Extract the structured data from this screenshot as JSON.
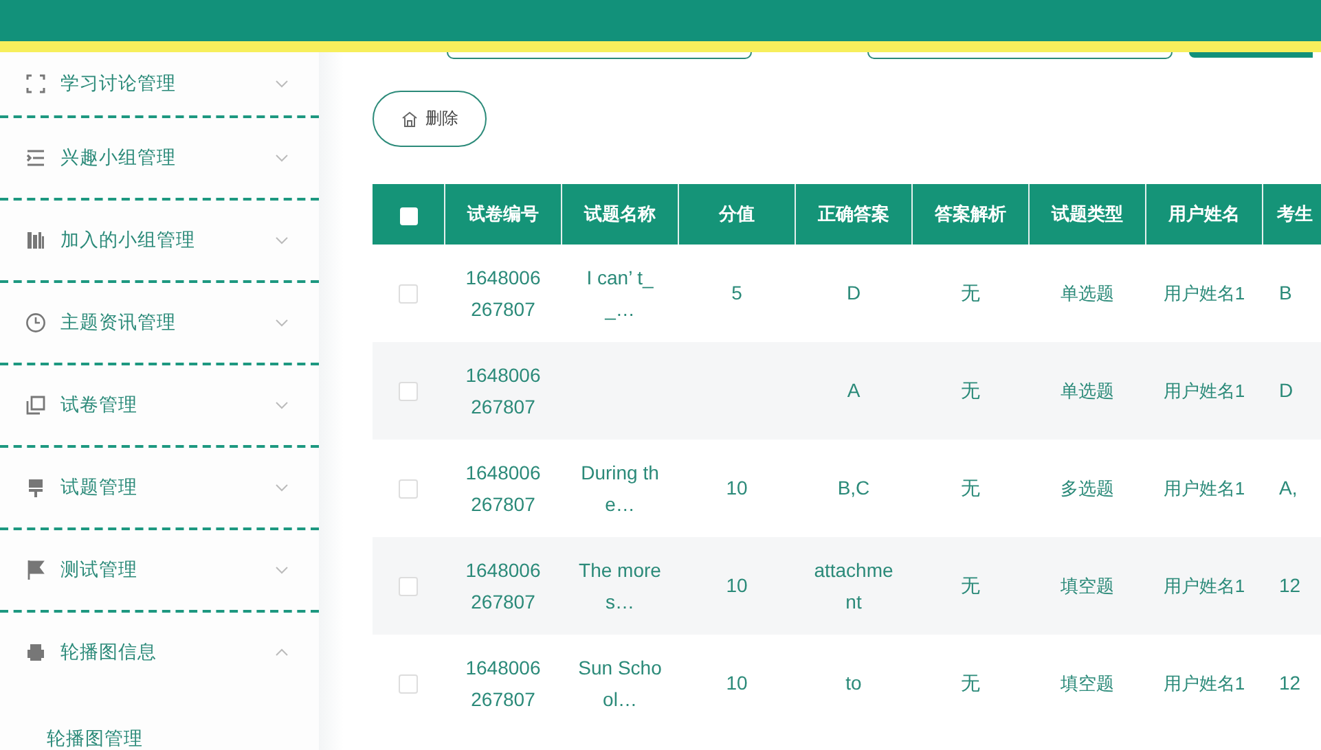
{
  "sidebar": {
    "items": [
      {
        "label": "学习讨论管理",
        "expanded": false
      },
      {
        "label": "兴趣小组管理",
        "expanded": false
      },
      {
        "label": "加入的小组管理",
        "expanded": false
      },
      {
        "label": "主题资讯管理",
        "expanded": false
      },
      {
        "label": "试卷管理",
        "expanded": false
      },
      {
        "label": "试题管理",
        "expanded": false
      },
      {
        "label": "测试管理",
        "expanded": false
      },
      {
        "label": "轮播图信息",
        "expanded": true,
        "children": [
          {
            "label": "轮播图管理"
          }
        ]
      }
    ]
  },
  "toolbar": {
    "delete_button": "删除"
  },
  "table": {
    "header_checkbox": {
      "checked": false
    },
    "columns": [
      "试卷编号",
      "试题名称",
      "分值",
      "正确答案",
      "答案解析",
      "试题类型",
      "用户姓名",
      "考生"
    ],
    "rows": [
      {
        "checked": false,
        "cells": [
          "1648006267807",
          "I can’ t__…",
          "5",
          "D",
          "无",
          "单选题",
          "用户姓名1",
          "B"
        ]
      },
      {
        "checked": false,
        "cells": [
          "1648006267807",
          "",
          "",
          "A",
          "无",
          "单选题",
          "用户姓名1",
          "D"
        ]
      },
      {
        "checked": false,
        "cells": [
          "1648006267807",
          "During the…",
          "10",
          "B,C",
          "无",
          "多选题",
          "用户姓名1",
          "A,"
        ]
      },
      {
        "checked": false,
        "cells": [
          "1648006267807",
          "The more s…",
          "10",
          "attachment",
          "无",
          "填空题",
          "用户姓名1",
          "12"
        ]
      },
      {
        "checked": false,
        "cells": [
          "1648006267807",
          "Sun School…",
          "10",
          "to",
          "无",
          "填空题",
          "用户姓名1",
          "12"
        ]
      }
    ]
  }
}
